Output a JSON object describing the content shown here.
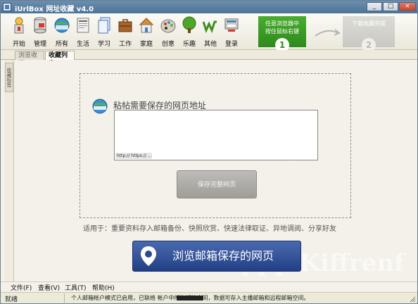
{
  "window": {
    "title": "iUrlBox 网址收藏 v4.0",
    "controls": {
      "minimize": "_",
      "maximize": "□",
      "close": "×"
    }
  },
  "toolbar": {
    "items": [
      {
        "label": "开始",
        "icon": "start-icon"
      },
      {
        "label": "管理",
        "icon": "database-icon"
      },
      {
        "label": "所有",
        "icon": "www-globe-icon"
      },
      {
        "label": "生活",
        "icon": "newspaper-icon"
      },
      {
        "label": "学习",
        "icon": "document-icon"
      },
      {
        "label": "工作",
        "icon": "briefcase-icon"
      },
      {
        "label": "家庭",
        "icon": "house-icon"
      },
      {
        "label": "创意",
        "icon": "palette-icon"
      },
      {
        "label": "乐趣",
        "icon": "tree-icon"
      },
      {
        "label": "其他",
        "icon": "w-logo-icon"
      },
      {
        "label": "登录",
        "icon": "login-icon"
      }
    ],
    "steps": [
      {
        "text_line1": "任意浏览器中",
        "text_line2": "按住鼠标右键",
        "number": "1"
      },
      {
        "text_line1": "下载收藏完成",
        "number": "2"
      }
    ]
  },
  "tabs": [
    {
      "label": "浏览收藏",
      "active": false
    },
    {
      "label": "收藏列表",
      "active": true
    }
  ],
  "sidebar": {
    "handle_label": "收藏标签"
  },
  "main": {
    "url_title": "粘帖需要保存的网页地址",
    "url_placeholder": "http:// https:// ...",
    "save_button": "保存完整网页",
    "usage_text": "适用于：重要资料存入邮箱备份、快照欣赏、快速法律取证、异地调阅、分享好友",
    "browse_button": "浏览邮箱保存的网页",
    "watermark": "uu ppp Kiffrenf"
  },
  "menu": [
    {
      "label": "文件(F)"
    },
    {
      "label": "查看(V)"
    },
    {
      "label": "工具(T)"
    },
    {
      "label": "帮助(H)"
    }
  ],
  "status": {
    "left": "就绪",
    "message": "个人邮箱帐户模式已启用，已联络 帐户中所有邮箱空间，数据可存入主播邮箱和远程邮箱空间。"
  },
  "colors": {
    "title_bar": "#5a80a5",
    "step_green": "#3a9a25",
    "browse_button": "#2a4a90",
    "save_button": "#aeada8"
  }
}
